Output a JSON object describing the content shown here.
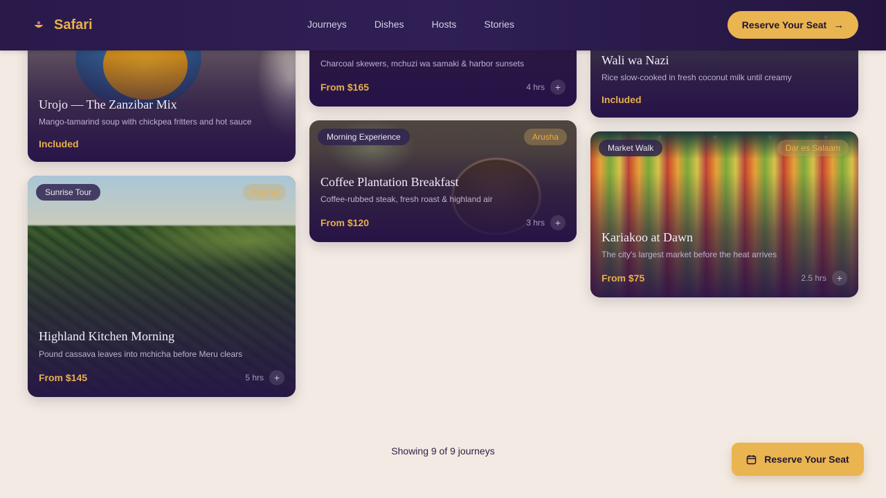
{
  "header": {
    "brand": "Safari",
    "nav": [
      "Journeys",
      "Dishes",
      "Hosts",
      "Stories"
    ],
    "cta_label": "Reserve Your Seat",
    "cta_arrow": "→"
  },
  "cards": {
    "urojo": {
      "title": "Urojo — The Zanzibar Mix",
      "desc": "Mango-tamarind soup with chickpea fritters and hot sauce",
      "price": "Included"
    },
    "skewers": {
      "desc": "Charcoal skewers, mchuzi wa samaki & harbor sunsets",
      "price": "From $165",
      "duration": "4 hrs"
    },
    "wali": {
      "title": "Wali wa Nazi",
      "desc": "Rice slow-cooked in fresh coconut milk until creamy",
      "price": "Included"
    },
    "highland": {
      "chip": "Sunrise Tour",
      "location": "Arusha",
      "title": "Highland Kitchen Morning",
      "desc": "Pound cassava leaves into mchicha before Meru clears",
      "price": "From $145",
      "duration": "5 hrs"
    },
    "coffee": {
      "chip": "Morning Experience",
      "location": "Arusha",
      "title": "Coffee Plantation Breakfast",
      "desc": "Coffee-rubbed steak, fresh roast & highland air",
      "price": "From $120",
      "duration": "3 hrs"
    },
    "kariakoo": {
      "chip": "Market Walk",
      "location": "Dar es Salaam",
      "title": "Kariakoo at Dawn",
      "desc": "The city's largest market before the heat arrives",
      "price": "From $75",
      "duration": "2.5 hrs"
    }
  },
  "plus_symbol": "+",
  "footer": {
    "showing": "Showing 9 of 9 journeys",
    "cta_label": "Reserve Your Seat"
  },
  "colors": {
    "accent": "#eab451",
    "header_bg": "#2a1a4a",
    "page_bg": "#f3ebe3"
  },
  "icons": [
    "food-bowl-icon",
    "arrow-right-icon",
    "plus-icon",
    "calendar-icon"
  ]
}
